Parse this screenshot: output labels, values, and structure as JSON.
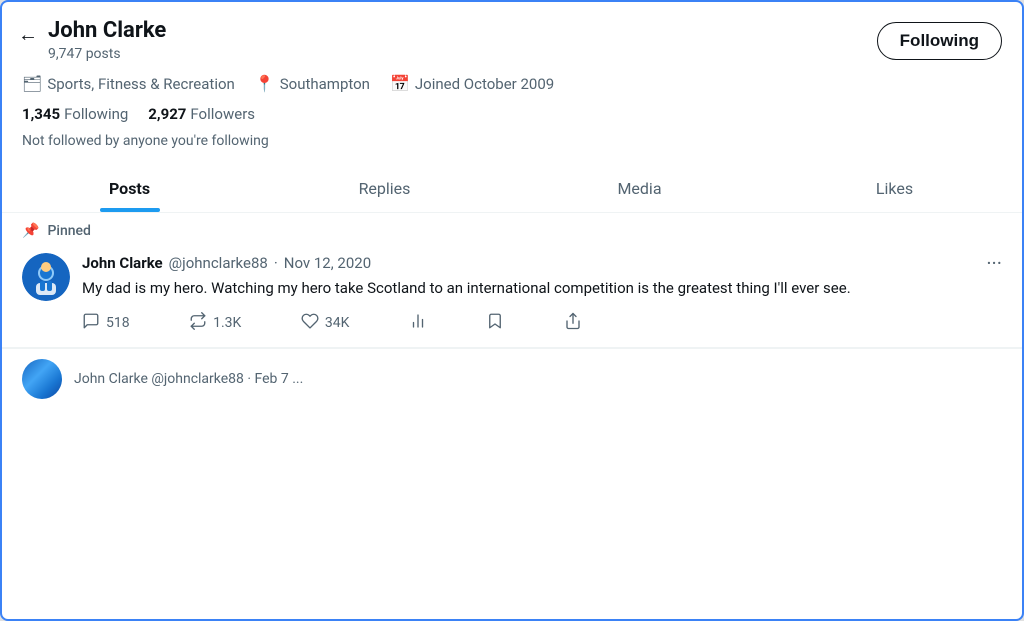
{
  "user": {
    "name": "John Clarke",
    "posts_count": "9,747 posts",
    "category": "Sports, Fitness & Recreation",
    "location": "Southampton",
    "joined": "Joined October 2009",
    "following_count": "1,345",
    "following_label": "Following",
    "followers_count": "2,927",
    "followers_label": "Followers",
    "not_followed_text": "Not followed by anyone you're following"
  },
  "following_button": "Following",
  "tabs": {
    "posts": "Posts",
    "replies": "Replies",
    "media": "Media",
    "likes": "Likes",
    "active": "posts"
  },
  "pinned": {
    "label": "Pinned"
  },
  "tweet": {
    "name": "John Clarke",
    "handle": "@johnclarke88",
    "date": "Nov 12, 2020",
    "text": "My dad is my hero. Watching my hero take Scotland to an international competition is the greatest thing I'll ever see.",
    "reply_count": "518",
    "retweet_count": "1.3K",
    "like_count": "34K",
    "bookmark_label": "",
    "share_label": ""
  },
  "back_icon": "←",
  "more_icon": "···",
  "category_icon": "🗂",
  "location_icon": "📍",
  "calendar_icon": "📅"
}
